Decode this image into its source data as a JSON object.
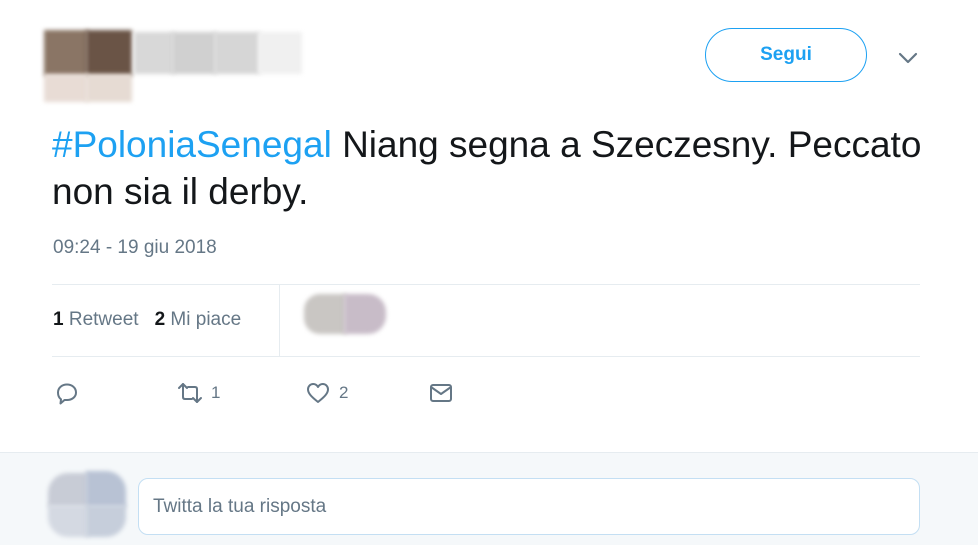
{
  "author": {
    "avatar_icon": "blurred-avatar-icon",
    "name_redacted": true
  },
  "header": {
    "follow_label": "Segui",
    "more_icon": "chevron-down-icon"
  },
  "tweet": {
    "hashtag": "#PoloniaSenegal",
    "text": " Niang segna a Szeczesny. Peccato non sia il derby.",
    "timestamp": "09:24 - 19 giu 2018"
  },
  "stats": {
    "retweet_count": "1",
    "retweet_label": "Retweet",
    "like_count": "2",
    "like_label": "Mi piace"
  },
  "actions": {
    "reply_icon": "reply-icon",
    "retweet_icon": "retweet-icon",
    "retweet_count": "1",
    "like_icon": "heart-icon",
    "like_count": "2",
    "dm_icon": "mail-icon"
  },
  "reply": {
    "placeholder": "Twitta la tua risposta"
  },
  "colors": {
    "accent": "#1da1f2",
    "muted": "#657786",
    "text": "#14171a",
    "reply_bg": "#f5f8fa"
  }
}
